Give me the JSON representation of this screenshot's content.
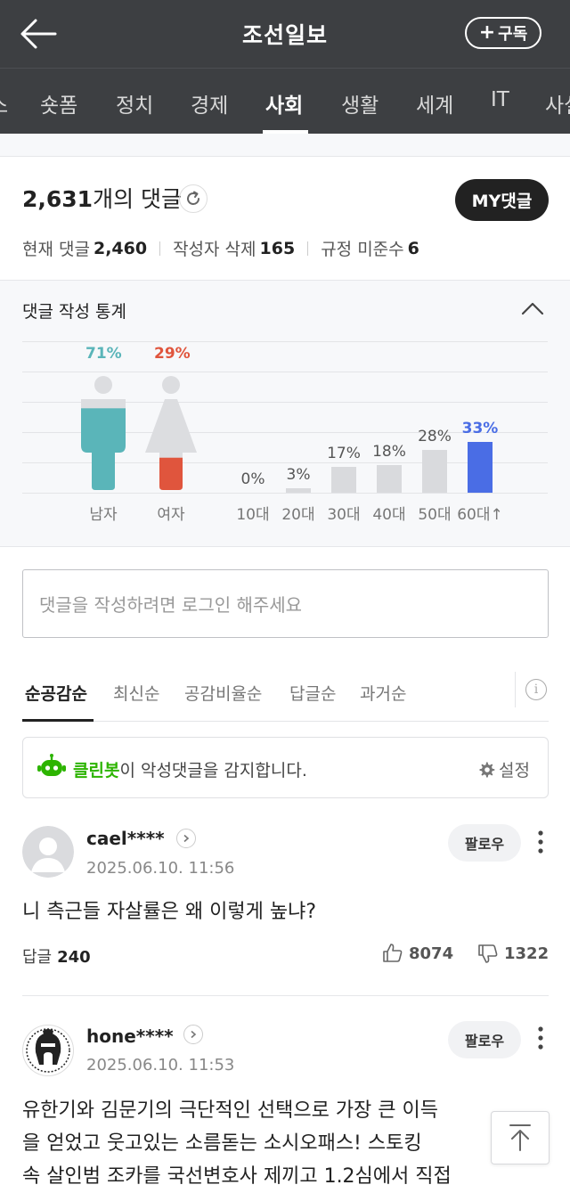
{
  "header": {
    "title": "조선일보",
    "subscribe_label": "구독"
  },
  "tabs": [
    {
      "label": "스",
      "active": false
    },
    {
      "label": "숏폼",
      "active": false
    },
    {
      "label": "정치",
      "active": false
    },
    {
      "label": "경제",
      "active": false
    },
    {
      "label": "사회",
      "active": true
    },
    {
      "label": "생활",
      "active": false
    },
    {
      "label": "세계",
      "active": false
    },
    {
      "label": "IT",
      "active": false
    },
    {
      "label": "사설",
      "active": false
    }
  ],
  "summary": {
    "total_count": "2,631",
    "total_suffix": "개의 댓글",
    "my_comments_label": "MY댓글",
    "current_label": "현재 댓글",
    "current_value": "2,460",
    "deleted_label": "작성자 삭제",
    "deleted_value": "165",
    "violation_label": "규정 미준수",
    "violation_value": "6"
  },
  "stats": {
    "title": "댓글 작성 통계",
    "colors": {
      "male": "#5ab5b9",
      "female": "#e0553d",
      "age": "#d9dadd",
      "age_highlight": "#4a6de5"
    },
    "gender": [
      {
        "label": "남자",
        "pct_text": "71%",
        "value": 71
      },
      {
        "label": "여자",
        "pct_text": "29%",
        "value": 29
      }
    ],
    "age": [
      {
        "label": "10대",
        "pct_text": "0%",
        "value": 0,
        "highlight": false
      },
      {
        "label": "20대",
        "pct_text": "3%",
        "value": 3,
        "highlight": false
      },
      {
        "label": "30대",
        "pct_text": "17%",
        "value": 17,
        "highlight": false
      },
      {
        "label": "40대",
        "pct_text": "18%",
        "value": 18,
        "highlight": false
      },
      {
        "label": "50대",
        "pct_text": "28%",
        "value": 28,
        "highlight": false
      },
      {
        "label": "60대↑",
        "pct_text": "33%",
        "value": 33,
        "highlight": true
      }
    ]
  },
  "input": {
    "placeholder": "댓글을 작성하려면 로그인 해주세요"
  },
  "sort": {
    "options": [
      "순공감순",
      "최신순",
      "공감비율순",
      "답글순",
      "과거순"
    ],
    "active_index": 0
  },
  "cleanbot": {
    "name": "클린봇",
    "message": "이 악성댓글을 감지합니다.",
    "settings_label": "설정"
  },
  "comments": [
    {
      "username": "cael****",
      "timestamp": "2025.06.10. 11:56",
      "follow_label": "팔로우",
      "body": "니 측근들 자살률은 왜 이렇게 높냐?",
      "reply_label": "답글",
      "reply_count": "240",
      "likes": "8074",
      "dislikes": "1322"
    },
    {
      "username": "hone****",
      "timestamp": "2025.06.10. 11:53",
      "follow_label": "팔로우",
      "body_lines": [
        "유한기와 김문기의 극단적인 선택으로 가장 큰 이득",
        "을 얻었고 웃고있는 소름돋는 소시오패스! 스토킹 ",
        "속 살인범 조카를 국선변호사 제끼고 1.2심에서 직접"
      ]
    }
  ]
}
